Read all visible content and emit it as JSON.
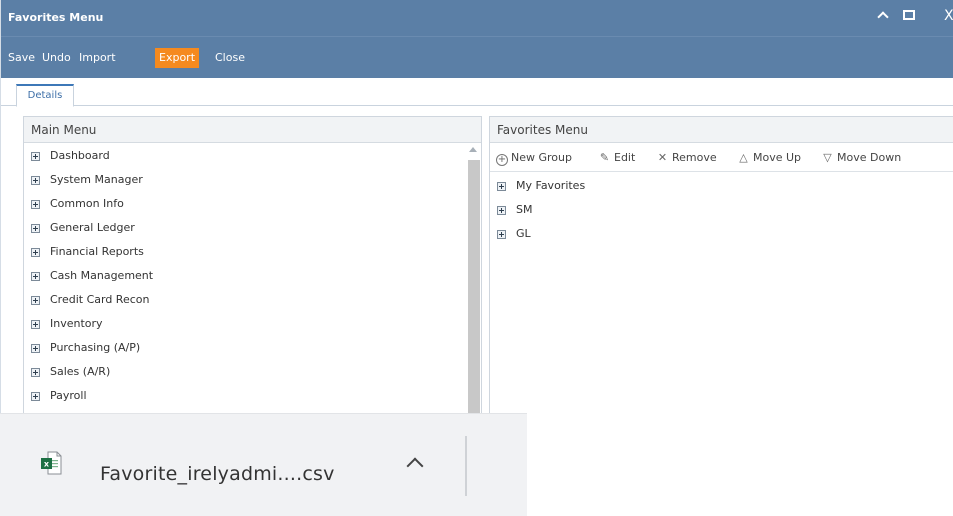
{
  "window": {
    "title": "Favorites Menu",
    "controls": {
      "minimize": "^",
      "close": "X"
    }
  },
  "toolbar": {
    "buttons": [
      {
        "label": "Save",
        "active": false
      },
      {
        "label": "Undo",
        "active": false
      },
      {
        "label": "Import",
        "active": false
      },
      {
        "label": "Export",
        "active": true
      },
      {
        "label": "Close",
        "active": false
      }
    ],
    "accent_color": "#f58a1f",
    "bar_color": "#5b7fa6"
  },
  "tabs": [
    {
      "label": "Details",
      "selected": true
    }
  ],
  "main_menu": {
    "header": "Main Menu",
    "items": [
      "Dashboard",
      "System Manager",
      "Common Info",
      "General Ledger",
      "Financial Reports",
      "Cash Management",
      "Credit Card Recon",
      "Inventory",
      "Purchasing (A/P)",
      "Sales (A/R)",
      "Payroll"
    ]
  },
  "favorites_menu": {
    "header": "Favorites Menu",
    "actions": [
      {
        "label": "New Group",
        "icon": "circle-plus-icon"
      },
      {
        "label": "Edit",
        "icon": "pencil-icon"
      },
      {
        "label": "Remove",
        "icon": "x-icon"
      },
      {
        "label": "Move Up",
        "icon": "triangle-up-icon"
      },
      {
        "label": "Move Down",
        "icon": "triangle-down-icon"
      }
    ],
    "items": [
      "My Favorites",
      "SM",
      "GL"
    ]
  },
  "download": {
    "file_name": "Favorite_irelyadmi....csv",
    "icon": "excel-file-icon"
  }
}
